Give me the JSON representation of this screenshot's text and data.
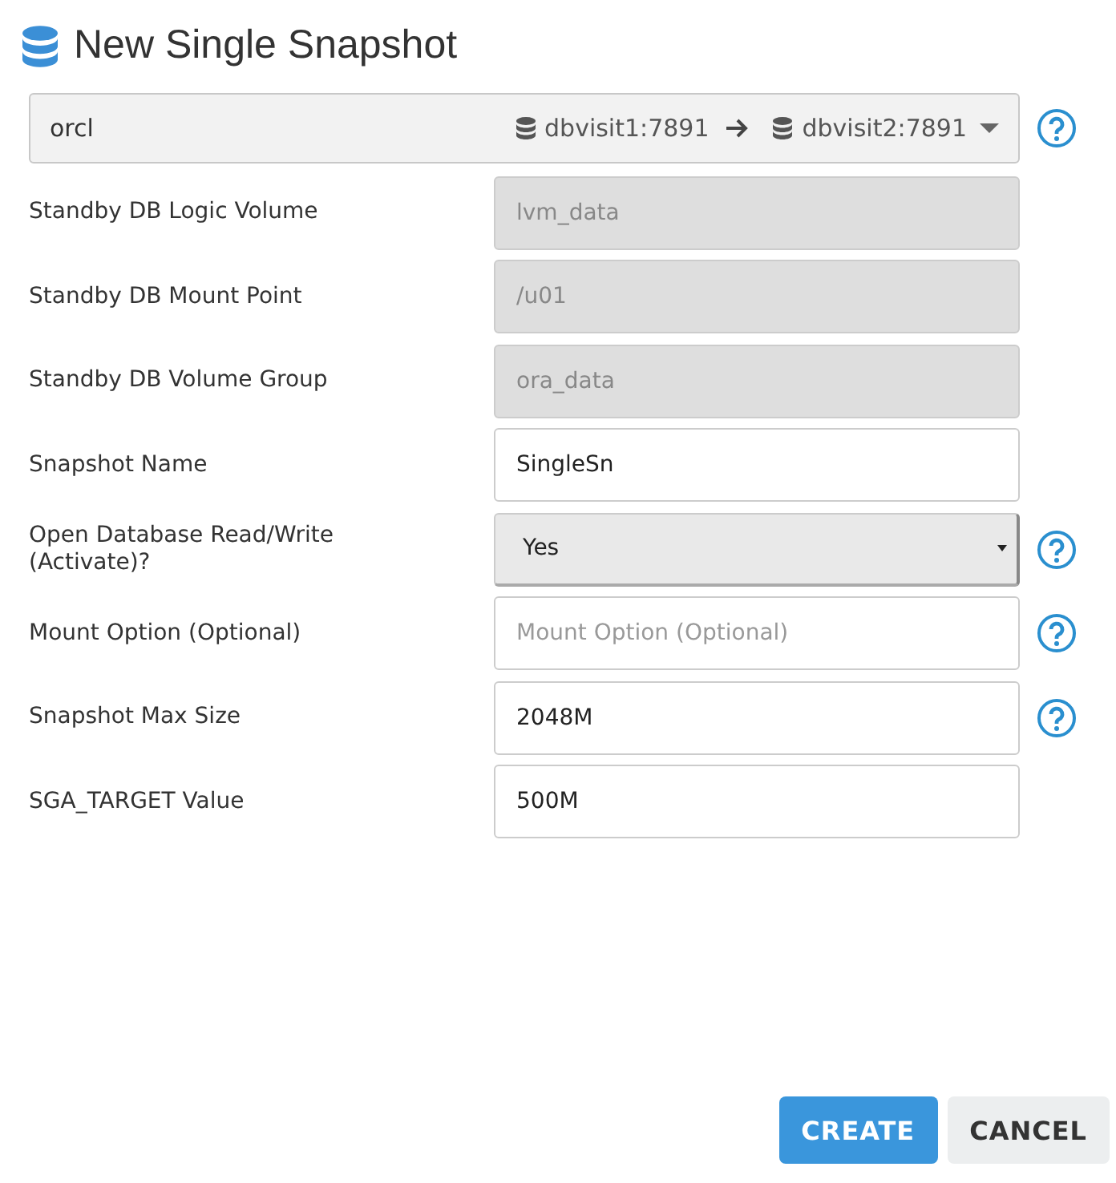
{
  "title": "New Single Snapshot",
  "source": {
    "database": "orcl",
    "from_host": "dbvisit1:7891",
    "to_host": "dbvisit2:7891",
    "help": true
  },
  "fields": [
    {
      "label": "Standby DB Logic Volume",
      "kind": "readonly",
      "value": "lvm_data",
      "help": false
    },
    {
      "label": "Standby DB Mount Point",
      "kind": "readonly",
      "value": "/u01",
      "help": false
    },
    {
      "label": "Standby DB Volume Group",
      "kind": "readonly",
      "value": "ora_data",
      "help": false
    },
    {
      "label": "Snapshot Name",
      "kind": "text",
      "value": "SingleSn",
      "help": false
    },
    {
      "label": "Open Database Read/Write (Activate)?",
      "kind": "select",
      "value": "Yes",
      "help": true
    },
    {
      "label": "Mount Option (Optional)",
      "kind": "text",
      "placeholder": "Mount Option (Optional)",
      "help": true
    },
    {
      "label": "Snapshot Max Size",
      "kind": "text",
      "value": "2048M",
      "help": true
    },
    {
      "label": "SGA_TARGET Value",
      "kind": "text",
      "value": "500M",
      "help": false
    }
  ],
  "buttons": [
    {
      "label": "CREATE",
      "kind": "primary"
    },
    {
      "label": "CANCEL",
      "kind": "secondary"
    }
  ]
}
